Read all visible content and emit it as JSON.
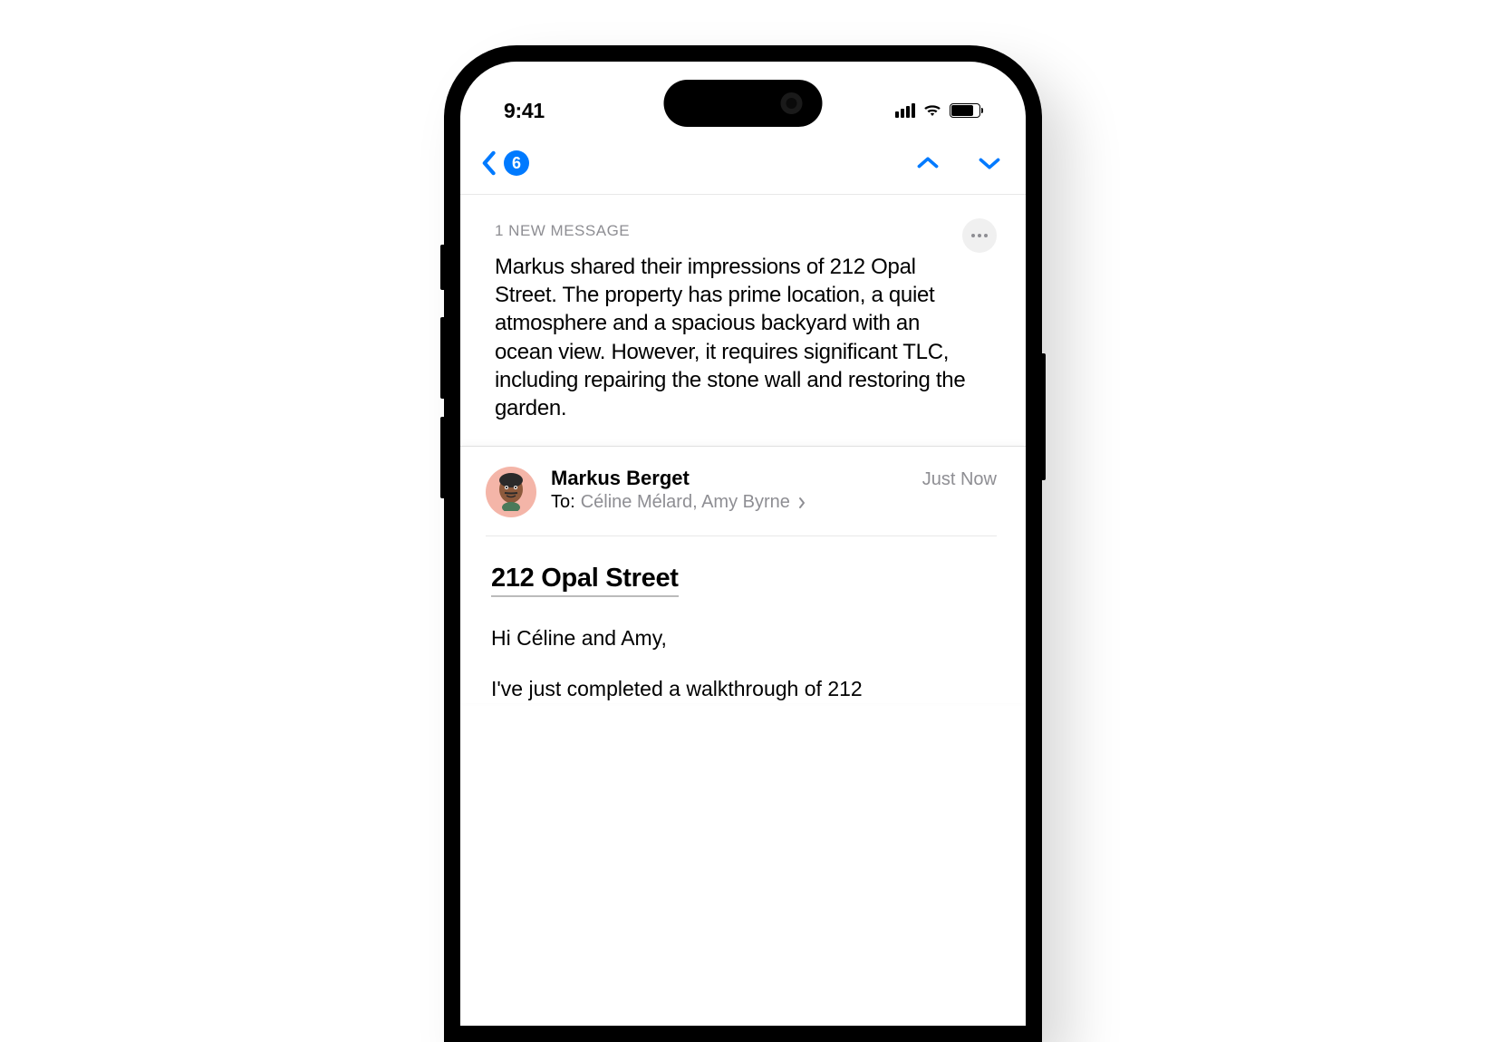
{
  "status": {
    "time": "9:41"
  },
  "nav": {
    "unread_count": "6"
  },
  "summary": {
    "label": "1 NEW MESSAGE",
    "text": "Markus shared their impressions of 212 Opal Street. The property has prime location, a quiet atmosphere and a spacious backyard with an ocean view. However, it requires significant TLC, including repairing the stone wall and restoring the garden."
  },
  "message": {
    "sender": "Markus Berget",
    "timestamp": "Just Now",
    "to_label": "To:",
    "recipients": "Céline Mélard, Amy Byrne",
    "subject": "212 Opal Street ",
    "greeting": "Hi Céline and Amy,",
    "body_start": "I've just completed a walkthrough of 212"
  }
}
